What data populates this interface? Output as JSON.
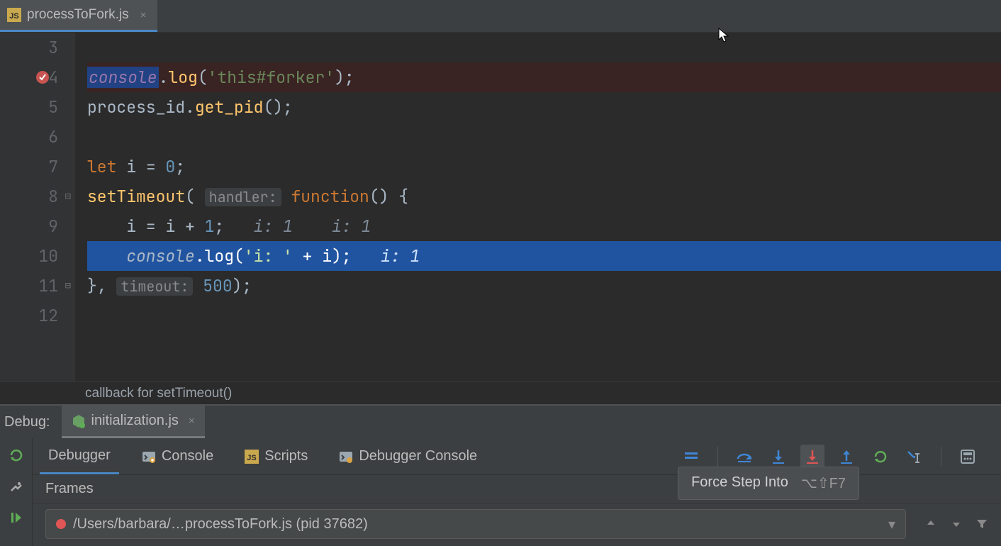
{
  "tab": {
    "filename": "processToFork.js",
    "close": "×"
  },
  "editor": {
    "lines": [
      "3",
      "4",
      "5",
      "6",
      "7",
      "8",
      "9",
      "10",
      "11",
      "12"
    ],
    "code": {
      "l4": {
        "obj": "console",
        "dot": ".",
        "fn": "log",
        "open": "(",
        "str": "'this#forker'",
        "close": ");"
      },
      "l5": {
        "id": "process_id",
        "dot": ".",
        "fn": "get_pid",
        "call": "();"
      },
      "l7": {
        "kw": "let ",
        "id": "i",
        "eq": " = ",
        "num": "0",
        "semi": ";"
      },
      "l8": {
        "fn": "setTimeout",
        "open": "( ",
        "hint": "handler:",
        "sp": " ",
        "kw": "function",
        "rest": "() {"
      },
      "l9": {
        "indent": "    ",
        "expr": "i = i + ",
        "num": "1",
        "semi": ";",
        "pad1": "   ",
        "inl1": "i: 1",
        "pad2": "    ",
        "inl2": "i: 1"
      },
      "l10": {
        "indent": "    ",
        "obj": "console",
        "dot": ".",
        "fn": "log",
        "open": "(",
        "str": "'i: '",
        "plus": " + i);",
        "pad": "   ",
        "inl": "i: 1"
      },
      "l11": {
        "close": "}, ",
        "hint": "timeout:",
        "sp": " ",
        "num": "500",
        "end": ");"
      }
    }
  },
  "breadcrumb": "callback for setTimeout()",
  "debug": {
    "label": "Debug:",
    "run_config": "initialization.js",
    "tabs": {
      "debugger": "Debugger",
      "console": "Console",
      "scripts": "Scripts",
      "debugger_console": "Debugger Console"
    },
    "frames": {
      "header": "Frames",
      "combo": "/Users/barbara/…processToFork.js (pid 37682)"
    },
    "tooltip": {
      "label": "Force Step Into",
      "shortcut": "⌥⇧F7"
    }
  },
  "icons": {
    "js": "JS",
    "node": "node"
  }
}
